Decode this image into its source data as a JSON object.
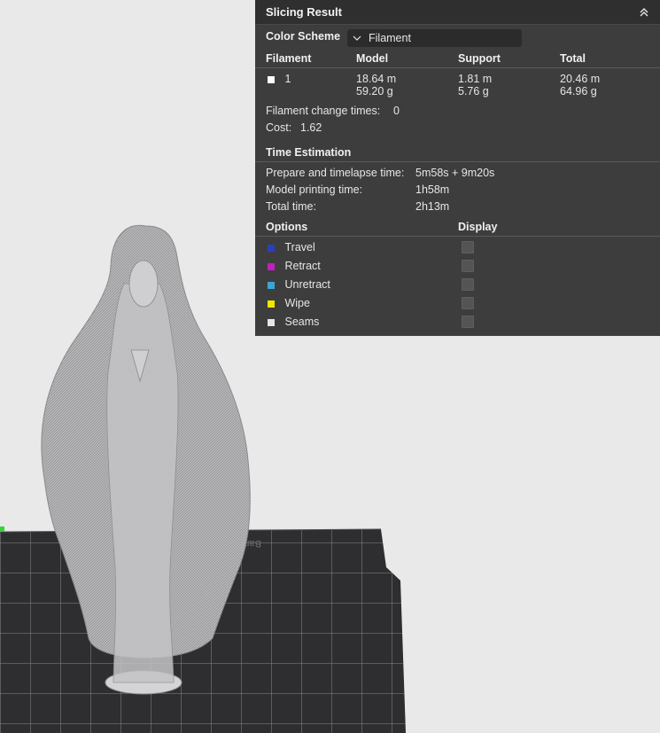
{
  "panel": {
    "title": "Slicing Result",
    "color_scheme_label": "Color Scheme",
    "color_scheme_value": "Filament",
    "filament_table": {
      "headers": [
        "Filament",
        "Model",
        "Support",
        "Total"
      ],
      "rows": [
        {
          "filament": "1",
          "model_length": "18.64 m",
          "model_weight": "59.20 g",
          "support_length": "1.81 m",
          "support_weight": "5.76 g",
          "total_length": "20.46 m",
          "total_weight": "64.96 g"
        }
      ]
    },
    "filament_change_label": "Filament change times:",
    "filament_change_value": "0",
    "cost_label": "Cost:",
    "cost_value": "1.62",
    "time_estimation": {
      "title": "Time Estimation",
      "prepare_label": "Prepare and timelapse time:",
      "prepare_value": "5m58s + 9m20s",
      "model_label": "Model printing time:",
      "model_value": "1h58m",
      "total_label": "Total time:",
      "total_value": "2h13m"
    },
    "options": {
      "header": "Options",
      "display_header": "Display",
      "items": [
        {
          "label": "Travel",
          "color": "#2a3fbf"
        },
        {
          "label": "Retract",
          "color": "#c21fc2"
        },
        {
          "label": "Unretract",
          "color": "#3aa6d6"
        },
        {
          "label": "Wipe",
          "color": "#f2e600"
        },
        {
          "label": "Seams",
          "color": "#e6e6e6"
        }
      ]
    }
  },
  "plate_text": "Bambu Textur"
}
